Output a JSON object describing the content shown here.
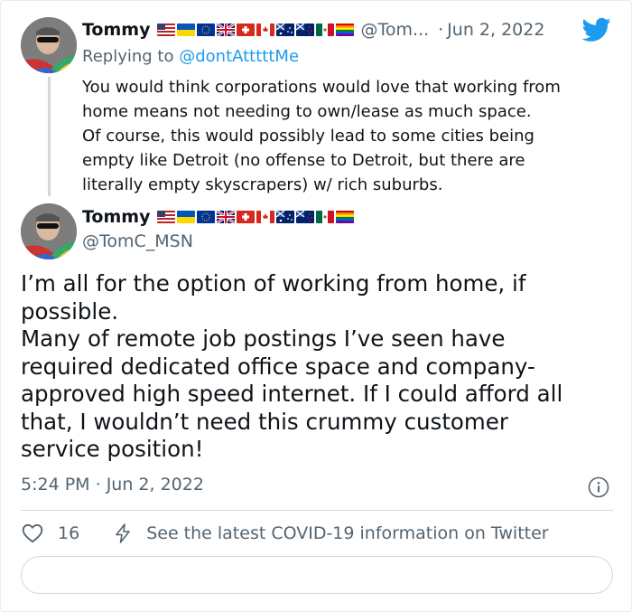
{
  "tweet1": {
    "display_name": "Tommy",
    "handle": "@Tom...",
    "date": "Jun 2, 2022",
    "reply_prefix": "Replying to",
    "reply_to": "@dontAtttttMe",
    "text": "You would think corporations would love that working from\nhome means not needing to own/lease as much space.\nOf course, this would possibly lead to some cities being\nempty like Detroit (no offense to Detroit, but there are\nliterally empty skyscrapers) w/ rich suburbs."
  },
  "tweet2": {
    "display_name": "Tommy",
    "handle": "@TomC_MSN",
    "text": "I’m all for the option of working from home, if\npossible.\nMany of remote job postings I’ve seen have\nrequired dedicated office space and company-\napproved high speed internet. If I could afford all\nthat, I wouldn’t need this crummy customer\nservice position!",
    "time": "5:24 PM",
    "date": "Jun 2, 2022",
    "likes": "16",
    "covid_link": "See the latest COVID-19 information on Twitter"
  },
  "flags": [
    "us-flag",
    "ukraine-flag",
    "eu-flag",
    "uk-flag",
    "switzerland-flag",
    "canada-flag",
    "australia-flag",
    "new-zealand-flag",
    "mexico-flag",
    "rainbow-flag"
  ],
  "icons": {
    "brand": "twitter-bird-icon",
    "info": "info-icon",
    "like": "heart-icon",
    "covid": "lightning-bolt-icon"
  },
  "colors": {
    "brand": "#1d9bf0",
    "text": "#0f1419",
    "secondary": "#536471",
    "border": "#cfd9de"
  }
}
